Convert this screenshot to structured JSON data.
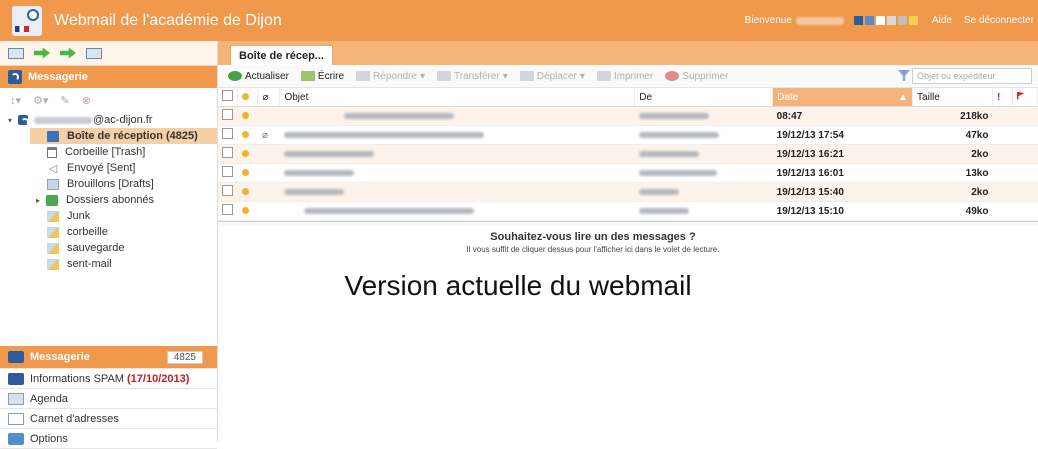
{
  "header": {
    "title": "Webmail de l'académie de Dijon",
    "welcome": "Bienvenue",
    "aide": "Aide",
    "logout": "Se déconnecter",
    "swatches": [
      "#2c5d9a",
      "#5a8ac6",
      "#ffffff",
      "#d9d9d9",
      "#bfbfbf",
      "#f2d34e"
    ]
  },
  "left": {
    "section_title": "Messagerie",
    "account": "@ac-dijon.fr",
    "folders": [
      {
        "label": "Boîte de réception (4825)",
        "icon": "inbox-icon",
        "selected": true
      },
      {
        "label": "Corbeille [Trash]",
        "icon": "trash-icon"
      },
      {
        "label": "Envoyé [Sent]",
        "icon": "sent-icon"
      },
      {
        "label": "Brouillons [Drafts]",
        "icon": "drafts-icon"
      },
      {
        "label": "Dossiers abonnés",
        "icon": "subscribed-folders-icon"
      },
      {
        "label": "Junk",
        "icon": "folder-icon"
      },
      {
        "label": "corbeille",
        "icon": "folder-icon"
      },
      {
        "label": "sauvegarde",
        "icon": "folder-icon"
      },
      {
        "label": "sent-mail",
        "icon": "folder-icon"
      }
    ],
    "bottom": {
      "messagerie": "Messagerie",
      "messagerie_count": "4825",
      "spam_label": "Informations SPAM",
      "spam_date": "(17/10/2013)",
      "agenda": "Agenda",
      "contacts": "Carnet d'adresses",
      "options": "Options"
    }
  },
  "main": {
    "tab": "Boîte de récep...",
    "actions": {
      "refresh": "Actualiser",
      "write": "Écrire",
      "reply": "Répondre",
      "forward": "Transférer",
      "move": "Déplacer",
      "print": "Imprimer",
      "delete": "Supprimer"
    },
    "search_placeholder": "Objet ou expéditeur",
    "columns": {
      "subject": "Objet",
      "from": "De",
      "date": "Date",
      "size": "Taille"
    },
    "rows": [
      {
        "date": "08:47",
        "size": "218ko",
        "attach": false
      },
      {
        "date": "19/12/13 17:54",
        "size": "47ko",
        "attach": true
      },
      {
        "date": "19/12/13 16:21",
        "size": "2ko",
        "attach": false
      },
      {
        "date": "19/12/13 16:01",
        "size": "13ko",
        "attach": false
      },
      {
        "date": "19/12/13 15:40",
        "size": "2ko",
        "attach": false
      },
      {
        "date": "19/12/13 15:10",
        "size": "49ko",
        "attach": false
      }
    ],
    "preview_question": "Souhaitez-vous lire un des messages ?",
    "preview_hint": "Il vous suffit de cliquer dessus pour l'afficher ici dans le volet de lecture."
  },
  "caption": "Version actuelle du webmail"
}
